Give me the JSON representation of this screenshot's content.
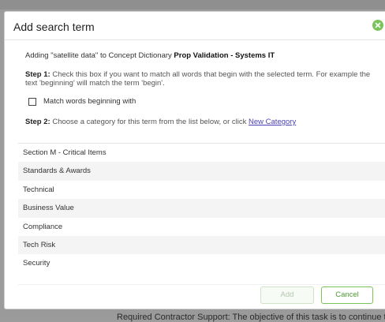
{
  "dialog": {
    "title": "Add search term",
    "intro": {
      "prefix": "Adding \"satellite data\" to Concept Dictionary ",
      "dictionary": "Prop Validation - Systems IT"
    },
    "step1": {
      "label": "Step 1:",
      "text": " Check this box if you want to match all words that begin with the selected term. For example the text 'beginning' will match the term 'begin'."
    },
    "checkbox": {
      "label": "Match words beginning with",
      "checked": false
    },
    "step2": {
      "label": "Step 2:",
      "text": " Choose a category for this term from the list below, or click ",
      "link": "New Category"
    },
    "categories": [
      "Section M - Critical Items",
      "Standards & Awards",
      "Technical",
      "Business Value",
      "Compliance",
      "Tech Risk",
      "Security"
    ],
    "buttons": {
      "add": "Add",
      "cancel": "Cancel"
    }
  },
  "background": {
    "snippet": "Required Contractor Support: The objective of this task is to continue to"
  },
  "colors": {
    "accent": "#7cc35a",
    "link": "#4a3fb2"
  },
  "icons": {
    "close": "close-icon"
  }
}
